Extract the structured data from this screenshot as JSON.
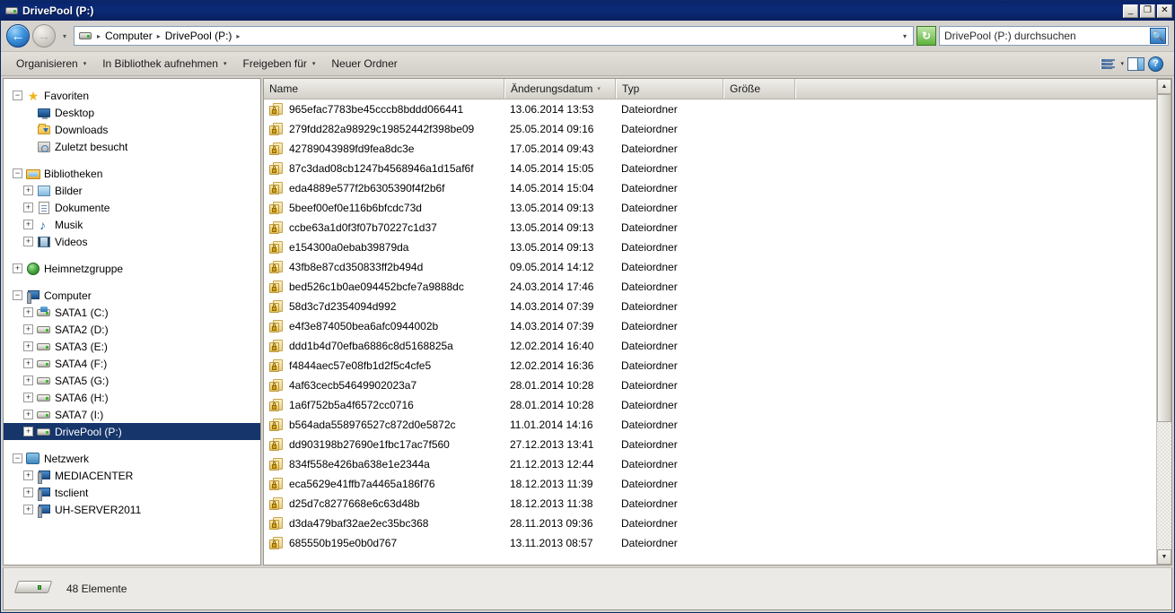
{
  "window": {
    "title": "DrivePool (P:)",
    "icon": "drive-icon",
    "buttons": {
      "minimize": "_",
      "maximize": "❐",
      "close": "✕"
    }
  },
  "addressbar": {
    "back_tooltip": "Zurück",
    "forward_tooltip": "Vorwärts",
    "history_caret": "▾",
    "drive_icon": "drive-icon",
    "crumbs": [
      "Computer",
      "DrivePool (P:)"
    ],
    "separator": "▸",
    "end_caret": "▾",
    "refresh_icon": "↻"
  },
  "search": {
    "placeholder": "DrivePool (P:) durchsuchen",
    "value": "",
    "icon": "search-icon"
  },
  "toolbar": {
    "items": [
      {
        "label": "Organisieren",
        "caret": "▾"
      },
      {
        "label": "In Bibliothek aufnehmen",
        "caret": "▾"
      },
      {
        "label": "Freigeben für",
        "caret": "▾"
      },
      {
        "label": "Neuer Ordner",
        "caret": ""
      }
    ],
    "view_caret": "▾",
    "help_label": "?"
  },
  "sidebar": {
    "groups": [
      {
        "name": "Favoriten",
        "expander": "−",
        "icon": "star-icon",
        "children": [
          {
            "label": "Desktop",
            "icon": "monitor-icon",
            "expander": ""
          },
          {
            "label": "Downloads",
            "icon": "download-folder-icon",
            "expander": ""
          },
          {
            "label": "Zuletzt besucht",
            "icon": "recent-places-icon",
            "expander": ""
          }
        ]
      },
      {
        "name": "Bibliotheken",
        "expander": "−",
        "icon": "library-icon",
        "children": [
          {
            "label": "Bilder",
            "icon": "pictures-icon",
            "expander": "+"
          },
          {
            "label": "Dokumente",
            "icon": "documents-icon",
            "expander": "+"
          },
          {
            "label": "Musik",
            "icon": "music-icon",
            "expander": "+"
          },
          {
            "label": "Videos",
            "icon": "videos-icon",
            "expander": "+"
          }
        ]
      },
      {
        "name": "Heimnetzgruppe",
        "expander": "+",
        "icon": "homegroup-icon",
        "children": []
      },
      {
        "name": "Computer",
        "expander": "−",
        "icon": "computer-icon",
        "children": [
          {
            "label": "SATA1 (C:)",
            "icon": "system-drive-icon",
            "expander": "+"
          },
          {
            "label": "SATA2 (D:)",
            "icon": "drive-icon",
            "expander": "+"
          },
          {
            "label": "SATA3 (E:)",
            "icon": "drive-icon",
            "expander": "+"
          },
          {
            "label": "SATA4 (F:)",
            "icon": "drive-icon",
            "expander": "+"
          },
          {
            "label": "SATA5 (G:)",
            "icon": "drive-icon",
            "expander": "+"
          },
          {
            "label": "SATA6 (H:)",
            "icon": "drive-icon",
            "expander": "+"
          },
          {
            "label": "SATA7 (I:)",
            "icon": "drive-icon",
            "expander": "+"
          },
          {
            "label": "DrivePool (P:)",
            "icon": "drive-icon",
            "expander": "+",
            "selected": true
          }
        ]
      },
      {
        "name": "Netzwerk",
        "expander": "−",
        "icon": "network-icon",
        "children": [
          {
            "label": "MEDIACENTER",
            "icon": "computer-icon",
            "expander": "+"
          },
          {
            "label": "tsclient",
            "icon": "computer-icon",
            "expander": "+"
          },
          {
            "label": "UH-SERVER2011",
            "icon": "computer-icon",
            "expander": "+"
          }
        ]
      }
    ],
    "selected_color": "#16366b"
  },
  "filelist": {
    "columns": [
      {
        "key": "name",
        "label": "Name",
        "sorted": false
      },
      {
        "key": "date",
        "label": "Änderungsdatum",
        "sorted": true,
        "sort_caret": "▾"
      },
      {
        "key": "type",
        "label": "Typ",
        "sorted": false
      },
      {
        "key": "size",
        "label": "Größe",
        "sorted": false
      }
    ],
    "rows": [
      {
        "name": "965efac7783be45cccb8bddd066441",
        "date": "13.06.2014 13:53",
        "type": "Dateiordner",
        "size": "",
        "icon": "locked-folder-icon"
      },
      {
        "name": "279fdd282a98929c19852442f398be09",
        "date": "25.05.2014 09:16",
        "type": "Dateiordner",
        "size": "",
        "icon": "locked-folder-icon"
      },
      {
        "name": "42789043989fd9fea8dc3e",
        "date": "17.05.2014 09:43",
        "type": "Dateiordner",
        "size": "",
        "icon": "locked-folder-icon"
      },
      {
        "name": "87c3dad08cb1247b4568946a1d15af6f",
        "date": "14.05.2014 15:05",
        "type": "Dateiordner",
        "size": "",
        "icon": "locked-folder-icon"
      },
      {
        "name": "eda4889e577f2b6305390f4f2b6f",
        "date": "14.05.2014 15:04",
        "type": "Dateiordner",
        "size": "",
        "icon": "locked-folder-icon"
      },
      {
        "name": "5beef00ef0e116b6bfcdc73d",
        "date": "13.05.2014 09:13",
        "type": "Dateiordner",
        "size": "",
        "icon": "locked-folder-icon"
      },
      {
        "name": "ccbe63a1d0f3f07b70227c1d37",
        "date": "13.05.2014 09:13",
        "type": "Dateiordner",
        "size": "",
        "icon": "locked-folder-icon"
      },
      {
        "name": "e154300a0ebab39879da",
        "date": "13.05.2014 09:13",
        "type": "Dateiordner",
        "size": "",
        "icon": "locked-folder-icon"
      },
      {
        "name": "43fb8e87cd350833ff2b494d",
        "date": "09.05.2014 14:12",
        "type": "Dateiordner",
        "size": "",
        "icon": "locked-folder-icon"
      },
      {
        "name": "bed526c1b0ae094452bcfe7a9888dc",
        "date": "24.03.2014 17:46",
        "type": "Dateiordner",
        "size": "",
        "icon": "locked-folder-icon"
      },
      {
        "name": "58d3c7d2354094d992",
        "date": "14.03.2014 07:39",
        "type": "Dateiordner",
        "size": "",
        "icon": "locked-folder-icon"
      },
      {
        "name": "e4f3e874050bea6afc0944002b",
        "date": "14.03.2014 07:39",
        "type": "Dateiordner",
        "size": "",
        "icon": "locked-folder-icon"
      },
      {
        "name": "ddd1b4d70efba6886c8d5168825a",
        "date": "12.02.2014 16:40",
        "type": "Dateiordner",
        "size": "",
        "icon": "locked-folder-icon"
      },
      {
        "name": "f4844aec57e08fb1d2f5c4cfe5",
        "date": "12.02.2014 16:36",
        "type": "Dateiordner",
        "size": "",
        "icon": "locked-folder-icon"
      },
      {
        "name": "4af63cecb54649902023a7",
        "date": "28.01.2014 10:28",
        "type": "Dateiordner",
        "size": "",
        "icon": "locked-folder-icon"
      },
      {
        "name": "1a6f752b5a4f6572cc0716",
        "date": "28.01.2014 10:28",
        "type": "Dateiordner",
        "size": "",
        "icon": "locked-folder-icon"
      },
      {
        "name": "b564ada558976527c872d0e5872c",
        "date": "11.01.2014 14:16",
        "type": "Dateiordner",
        "size": "",
        "icon": "locked-folder-icon"
      },
      {
        "name": "dd903198b27690e1fbc17ac7f560",
        "date": "27.12.2013 13:41",
        "type": "Dateiordner",
        "size": "",
        "icon": "locked-folder-icon"
      },
      {
        "name": "834f558e426ba638e1e2344a",
        "date": "21.12.2013 12:44",
        "type": "Dateiordner",
        "size": "",
        "icon": "locked-folder-icon"
      },
      {
        "name": "eca5629e41ffb7a4465a186f76",
        "date": "18.12.2013 11:39",
        "type": "Dateiordner",
        "size": "",
        "icon": "locked-folder-icon"
      },
      {
        "name": "d25d7c8277668e6c63d48b",
        "date": "18.12.2013 11:38",
        "type": "Dateiordner",
        "size": "",
        "icon": "locked-folder-icon"
      },
      {
        "name": "d3da479baf32ae2ec35bc368",
        "date": "28.11.2013 09:36",
        "type": "Dateiordner",
        "size": "",
        "icon": "locked-folder-icon"
      },
      {
        "name": "685550b195e0b0d767",
        "date": "13.11.2013 08:57",
        "type": "Dateiordner",
        "size": "",
        "icon": "locked-folder-icon"
      }
    ],
    "scrollbar": {
      "up": "▲",
      "down": "▼",
      "thumb_percent": 72
    }
  },
  "statusbar": {
    "icon": "drive-icon",
    "text": "48 Elemente"
  }
}
